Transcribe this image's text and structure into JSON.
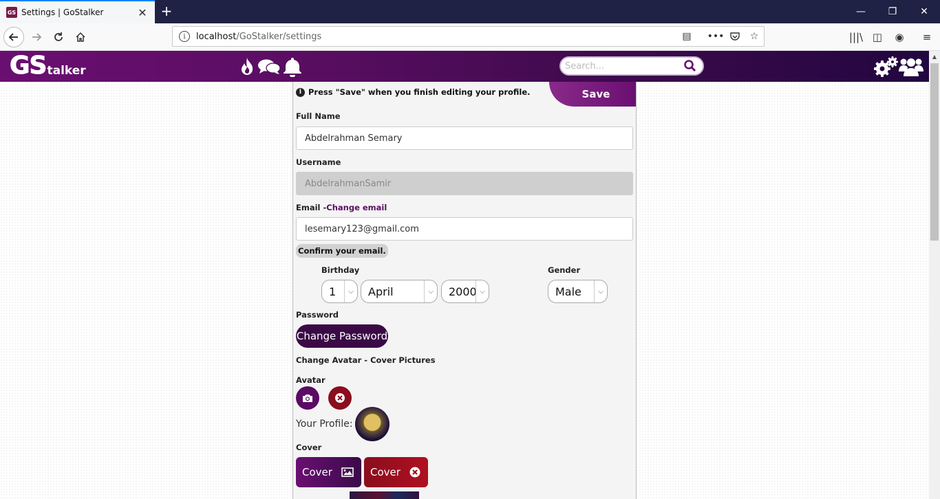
{
  "browser": {
    "tab_title": "Settings | GoStalker",
    "tab_favicon_text": "GS",
    "url_host": "localhost",
    "url_path": "/GoStalker/settings"
  },
  "header": {
    "logo_big": "GS",
    "logo_small": "talker",
    "search_placeholder": "Search..."
  },
  "settings": {
    "notice": "Press \"Save\" when you finish editing your profile.",
    "save_label": "Save",
    "full_name_label": "Full Name",
    "full_name_value": "Abdelrahman Semary",
    "username_label": "Username",
    "username_value": "AbdelrahmanSamir",
    "email_label": "Email -",
    "change_email_link": "Change email",
    "email_value": "lesemary123@gmail.com",
    "confirm_email": "Confirm your email.",
    "birthday_label": "Birthday",
    "birth_day": "1",
    "birth_month": "April",
    "birth_year": "2000",
    "gender_label": "Gender",
    "gender_value": "Male",
    "password_label": "Password",
    "change_password_label": "Change Password",
    "pictures_heading": "Change Avatar - Cover Pictures",
    "avatar_label": "Avatar",
    "your_profile_label": "Your Profile:",
    "cover_label": "Cover",
    "cover_upload_label": "Cover",
    "cover_remove_label": "Cover"
  },
  "colors": {
    "brand_purple": "#6a0f72",
    "brand_dark": "#3b0a46",
    "danger_red": "#9a0b1a"
  }
}
